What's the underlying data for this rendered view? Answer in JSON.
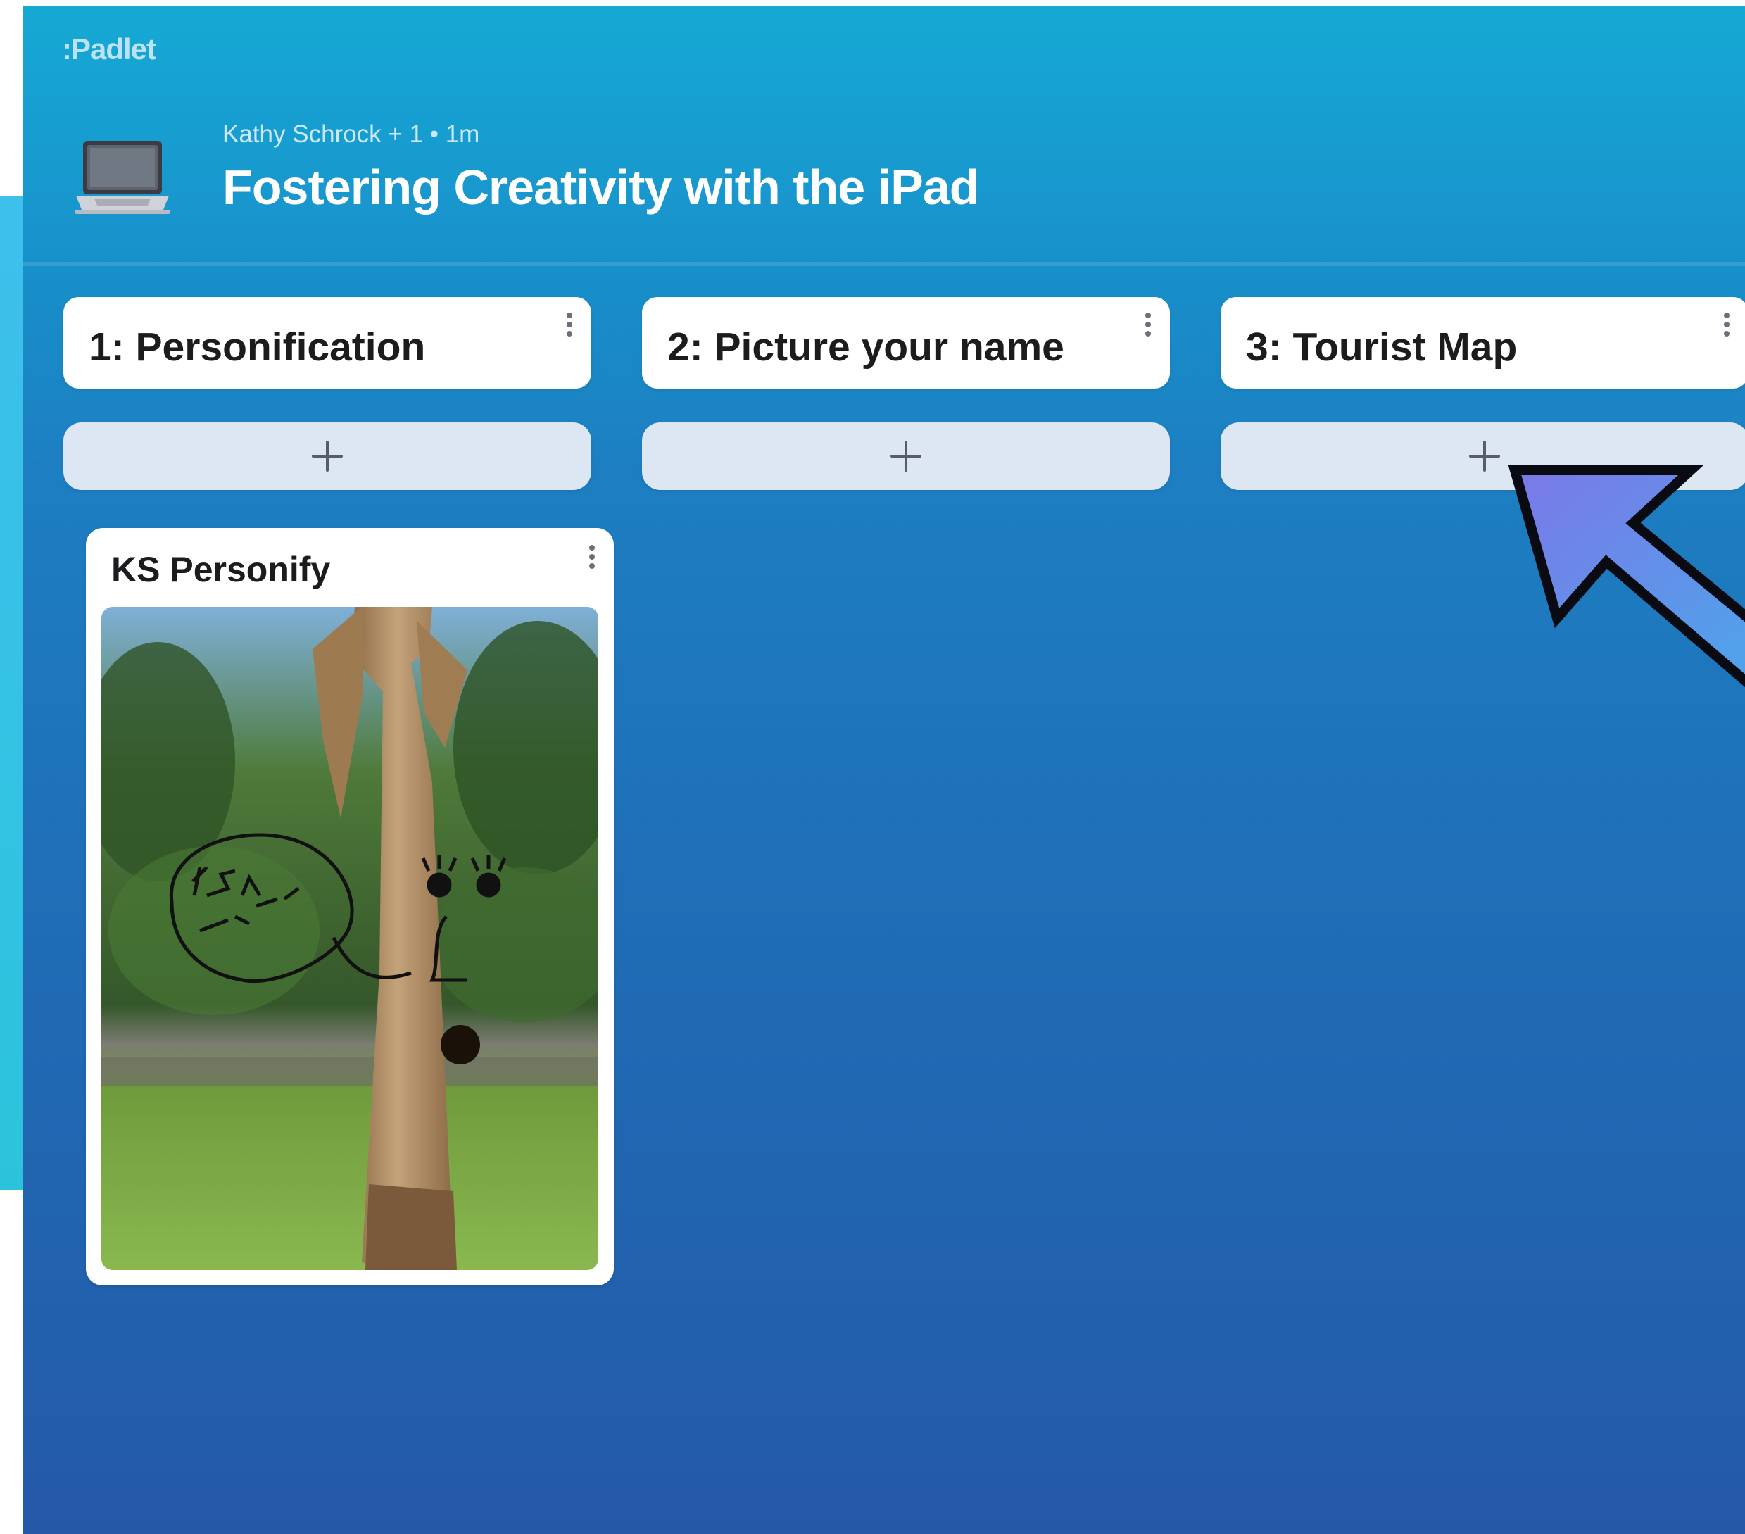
{
  "app": {
    "brand": ":Padlet"
  },
  "header": {
    "meta": "Kathy Schrock + 1 • 1m",
    "title": "Fostering Creativity with the iPad",
    "icon": "laptop-icon"
  },
  "columns": [
    {
      "title": "1: Personification",
      "add_label": "+"
    },
    {
      "title": "2: Picture your name",
      "add_label": "+"
    },
    {
      "title": "3: Tourist Map",
      "add_label": "+"
    }
  ],
  "posts": [
    {
      "title": "KS Personify",
      "image": {
        "subject": "carved wooden post with drawn face",
        "speech_bubble_text": "I AM SCARED!"
      }
    }
  ],
  "annotation": {
    "icon": "pointer-arrow-icon",
    "color": "#6f86e6"
  },
  "colors": {
    "background_top": "#07a4d2",
    "background_bottom": "#2459a8",
    "card": "#ffffff",
    "add_button": "#dde6f3"
  }
}
